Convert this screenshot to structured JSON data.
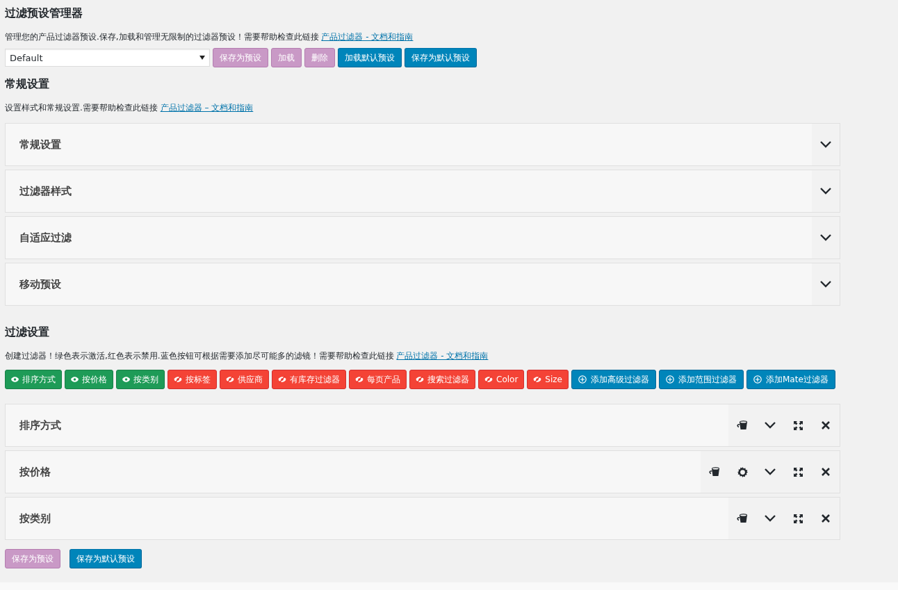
{
  "preset_manager": {
    "title": "过滤预设管理器",
    "description": "管理您的产品过滤器预设.保存,加载和管理无限制的过滤器预设！需要帮助检查此链接",
    "link": "产品过滤器 - 文档和指南",
    "select_value": "Default",
    "buttons": [
      {
        "label": "保存为预设",
        "kind": "secondary"
      },
      {
        "label": "加载",
        "kind": "secondary"
      },
      {
        "label": "删除",
        "kind": "secondary"
      },
      {
        "label": "加载默认预设",
        "kind": "primary"
      },
      {
        "label": "保存为默认预设",
        "kind": "primary"
      }
    ]
  },
  "general_settings": {
    "title": "常规设置",
    "description": "设置样式和常规设置.需要帮助检查此链接",
    "link": "产品过滤器 – 文档和指南",
    "sections": [
      {
        "title": "常规设置",
        "expanded": false
      },
      {
        "title": "过滤器样式",
        "expanded": false
      },
      {
        "title": "自适应过滤",
        "expanded": false
      },
      {
        "title": "移动预设",
        "expanded": false
      }
    ]
  },
  "filter_settings": {
    "title": "过滤设置",
    "description": "创建过滤器！绿色表示激活,红色表示禁用.蓝色按钮可根据需要添加尽可能多的滤镜！需要帮助检查此链接",
    "link": "产品过滤器 - 文档和指南",
    "filter_buttons": [
      {
        "label": "排序方式",
        "kind": "enabled"
      },
      {
        "label": "按价格",
        "kind": "enabled"
      },
      {
        "label": "按类别",
        "kind": "enabled"
      },
      {
        "label": "按标签",
        "kind": "disabled"
      },
      {
        "label": "供应商",
        "kind": "disabled"
      },
      {
        "label": "有库存过滤器",
        "kind": "disabled"
      },
      {
        "label": "每页产品",
        "kind": "disabled"
      },
      {
        "label": "搜索过滤器",
        "kind": "disabled"
      },
      {
        "label": "Color",
        "kind": "disabled"
      },
      {
        "label": "Size",
        "kind": "disabled"
      },
      {
        "label": "添加高级过滤器",
        "kind": "add"
      },
      {
        "label": "添加范围过滤器",
        "kind": "add"
      },
      {
        "label": "添加Mate过滤器",
        "kind": "add"
      }
    ],
    "filters": [
      {
        "title": "排序方式",
        "has_settings": false,
        "expanded": false
      },
      {
        "title": "按价格",
        "has_settings": true,
        "expanded": false
      },
      {
        "title": "按类别",
        "has_settings": false,
        "expanded": false
      }
    ]
  },
  "footer_buttons": [
    {
      "label": "保存为预设",
      "kind": "secondary"
    },
    {
      "label": "保存为默认预设",
      "kind": "primary"
    }
  ]
}
